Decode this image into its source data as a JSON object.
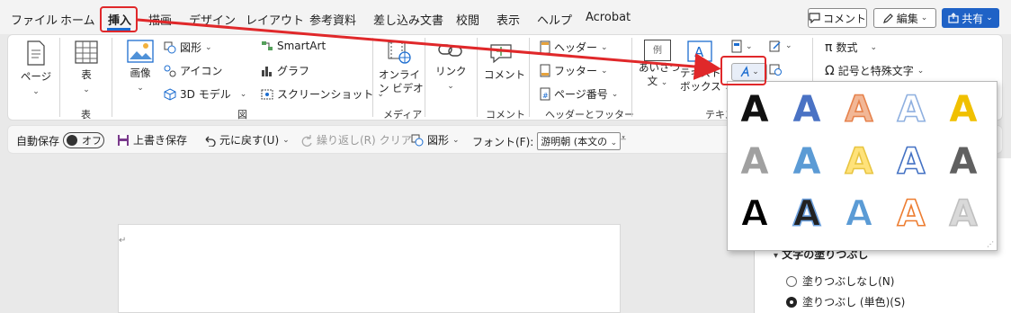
{
  "menu": {
    "tabs": [
      {
        "label": "ファイル"
      },
      {
        "label": "ホーム"
      },
      {
        "label": "挿入"
      },
      {
        "label": "描画"
      },
      {
        "label": "デザイン"
      },
      {
        "label": "レイアウト"
      },
      {
        "label": "参考資料"
      },
      {
        "label": "差し込み文書"
      },
      {
        "label": "校閲"
      },
      {
        "label": "表示"
      },
      {
        "label": "ヘルプ"
      },
      {
        "label": "Acrobat"
      }
    ],
    "comment_btn": "コメント",
    "edit_btn": "編集",
    "share_btn": "共有"
  },
  "ribbon": {
    "pages": {
      "label": "ページ"
    },
    "table": {
      "label": "表",
      "group": "表"
    },
    "illustrations": {
      "image": "画像",
      "shapes": "図形",
      "icons": "アイコン",
      "models": "3D モデル",
      "smartart": "SmartArt",
      "chart": "グラフ",
      "screenshot": "スクリーンショット",
      "group": "図"
    },
    "media": {
      "online_video_1": "オンライ",
      "online_video_2": "ン ビデオ",
      "group": "メディア"
    },
    "links": {
      "label": "リンク"
    },
    "comments": {
      "label": "コメント",
      "group": "コメント"
    },
    "header_footer": {
      "header": "ヘッダー",
      "footer": "フッター",
      "page_number": "ページ番号",
      "group": "ヘッダーとフッター"
    },
    "text": {
      "greeting_1": "あいさつ",
      "greeting_2": "文",
      "greeting_icon_text": "例",
      "textbox_1": "テキスト",
      "textbox_2": "ボックス",
      "group": "テキスト"
    },
    "symbols": {
      "equation": "数式",
      "symbol": "記号と特殊文字"
    }
  },
  "qat": {
    "autosave": "自動保存",
    "autosave_state": "オフ",
    "save": "上書き保存",
    "undo": "元に戻す(U)",
    "redo": "繰り返し(R)",
    "clear": "クリア",
    "shapes": "図形",
    "font_label": "フォント(F):",
    "font_value": "游明朝 (本文の"
  },
  "document": {
    "para_mark": "↵"
  },
  "pane": {
    "heading": "文字の塗りつぶし",
    "option_none": "塗りつぶしなし(N)",
    "option_solid": "塗りつぶし (単色)(S)"
  },
  "wordart": {
    "letter": "A",
    "styles": [
      {
        "fill": "#111111",
        "stroke": "none"
      },
      {
        "fill": "#4a72c4",
        "stroke": "none"
      },
      {
        "fill": "#f2b796",
        "stroke": "#e6824c"
      },
      {
        "fill": "#ffffff",
        "stroke": "#8fb0e0"
      },
      {
        "fill": "#f0c000",
        "stroke": "none"
      },
      {
        "fill": "#a0a0a0",
        "stroke": "none"
      },
      {
        "fill": "#5b9bd5",
        "stroke": "none"
      },
      {
        "fill": "#ffe27a",
        "stroke": "#e8c542"
      },
      {
        "fill": "#ffffff",
        "stroke": "#4472c4"
      },
      {
        "fill": "#606060",
        "stroke": "none"
      },
      {
        "fill": "#000000",
        "stroke": "#ffffff"
      },
      {
        "fill": "#222222",
        "stroke": "#6da0dd"
      },
      {
        "fill": "#5b9bd5",
        "stroke": "#ffffff"
      },
      {
        "fill": "#ffffff",
        "stroke": "#ed7d31"
      },
      {
        "fill": "#d9d9d9",
        "stroke": "#bfbfbf"
      }
    ]
  },
  "colors": {
    "accent": "#1c6dd0",
    "annotation_red": "#e0282a",
    "share_blue": "#1f62c6"
  }
}
